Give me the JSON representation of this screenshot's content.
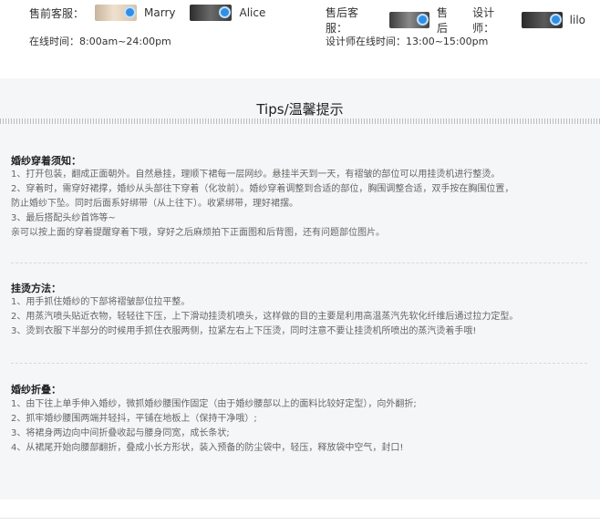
{
  "presale": {
    "label": "售前客服：",
    "agents": [
      {
        "name": "Marry"
      },
      {
        "name": "Alice"
      }
    ],
    "hours": "在线时间：8:00am~24:00pm"
  },
  "aftersale": {
    "label": "售后客服：",
    "agent_name": "售后",
    "designer_label": "设计师：",
    "designer_name": "lilo",
    "hours": "设计师在线时间：13:00~15:00pm"
  },
  "tips": {
    "title": "Tips/温馨提示",
    "sections": [
      {
        "title": "婚纱穿着须知：",
        "lines": [
          "1、打开包装，翻成正面朝外。自然悬挂，理顺下裙每一层网纱。悬挂半天到一天，有褶皱的部位可以用挂烫机进行整烫。",
          "2、穿着时，需穿好裙撑，婚纱从头部往下穿着（化妆前）。婚纱穿着调整到合适的部位，胸围调整合适，双手按在胸围位置，",
          "    防止婚纱下坠。同时后面系好绑带（从上往下）。收紧绑带，理好裙摆。",
          "3、最后搭配头纱首饰等~",
          "亲可以按上面的穿着提醒穿着下哦，穿好之后麻烦拍下正面图和后背图，还有问题部位图片。"
        ]
      },
      {
        "title": "挂烫方法：",
        "lines": [
          "1、用手抓住婚纱的下部将褶皱部位拉平整。",
          "2、用蒸汽喷头贴近衣物，轻轻往下压，上下滑动挂烫机喷头，这样做的目的主要是利用高温蒸汽先软化纤维后通过拉力定型。",
          "3、烫到衣服下半部分的时候用手抓住衣服两侧，拉紧左右上下压烫，同时注意不要让挂烫机所喷出的蒸汽烫着手哦!"
        ]
      },
      {
        "title": "婚纱折叠：",
        "lines": [
          "1、由下往上单手伸入婚纱，微抓婚纱腰围作固定（由于婚纱腰部以上的面料比较好定型），向外翻折;",
          "2、抓牢婚纱腰围两端并轻抖，平铺在地板上（保持干净哦）;",
          "3、将裙身两边向中间折叠收起与腰身同宽，成长条状;",
          "4、从裙尾开始向腰部翻折，叠成小长方形状，装入预备的防尘袋中，轻压，释放袋中空气，封口!"
        ]
      }
    ]
  }
}
